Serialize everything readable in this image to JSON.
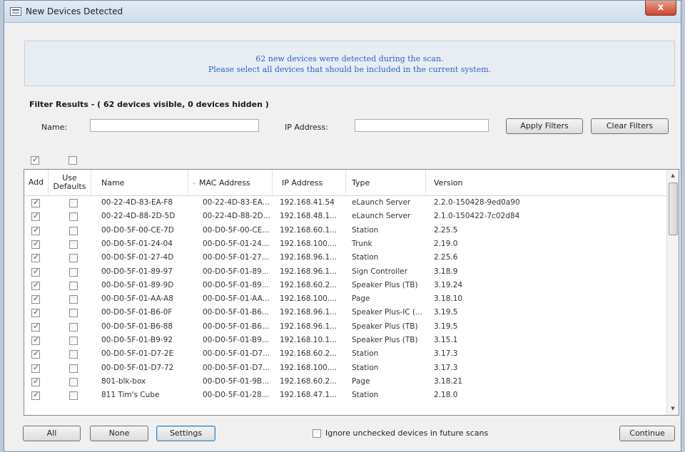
{
  "window": {
    "title": "New Devices Detected",
    "close_glyph": "x"
  },
  "banner": {
    "line1": "62 new devices were detected during the scan.",
    "line2": "Please select all devices that should be included in the current system."
  },
  "filter": {
    "title": "Filter Results - ( 62 devices visible, 0 devices hidden )",
    "name_label": "Name:",
    "name_value": "",
    "ip_label": "IP Address:",
    "ip_value": "",
    "apply_label": "Apply Filters",
    "clear_label": "Clear Filters"
  },
  "header_checks": {
    "add_all": true,
    "use_defaults_all": false
  },
  "table": {
    "columns": {
      "add": "Add",
      "use_defaults": "Use Defaults",
      "name": "Name",
      "sort_glyph": "-",
      "mac": "MAC Address",
      "ip": "IP Address",
      "type": "Type",
      "version": "Version"
    },
    "rows": [
      {
        "add": true,
        "use_defaults": false,
        "name": "00-22-4D-83-EA-F8",
        "mac": "00-22-4D-83-EA...",
        "ip": "192.168.41.54",
        "type": "eLaunch Server",
        "version": "2.2.0-150428-9ed0a90"
      },
      {
        "add": true,
        "use_defaults": false,
        "name": "00-22-4D-88-2D-5D",
        "mac": "00-22-4D-88-2D...",
        "ip": "192.168.48.1...",
        "type": "eLaunch Server",
        "version": "2.1.0-150422-7c02d84"
      },
      {
        "add": true,
        "use_defaults": false,
        "name": "00-D0-5F-00-CE-7D",
        "mac": "00-D0-5F-00-CE...",
        "ip": "192.168.60.1...",
        "type": "Station",
        "version": "2.25.5"
      },
      {
        "add": true,
        "use_defaults": false,
        "name": "00-D0-5F-01-24-04",
        "mac": "00-D0-5F-01-24...",
        "ip": "192.168.100....",
        "type": "Trunk",
        "version": "2.19.0"
      },
      {
        "add": true,
        "use_defaults": false,
        "name": "00-D0-5F-01-27-4D",
        "mac": "00-D0-5F-01-27...",
        "ip": "192.168.96.1...",
        "type": "Station",
        "version": "2.25.6"
      },
      {
        "add": true,
        "use_defaults": false,
        "name": "00-D0-5F-01-89-97",
        "mac": "00-D0-5F-01-89...",
        "ip": "192.168.96.1...",
        "type": "Sign Controller",
        "version": "3.18.9"
      },
      {
        "add": true,
        "use_defaults": false,
        "name": "00-D0-5F-01-89-9D",
        "mac": "00-D0-5F-01-89...",
        "ip": "192.168.60.2...",
        "type": "Speaker Plus (TB)",
        "version": "3.19.24"
      },
      {
        "add": true,
        "use_defaults": false,
        "name": "00-D0-5F-01-AA-A8",
        "mac": "00-D0-5F-01-AA...",
        "ip": "192.168.100....",
        "type": "Page",
        "version": "3.18.10"
      },
      {
        "add": true,
        "use_defaults": false,
        "name": "00-D0-5F-01-B6-0F",
        "mac": "00-D0-5F-01-B6...",
        "ip": "192.168.96.1...",
        "type": "Speaker Plus-IC (...",
        "version": "3.19.5"
      },
      {
        "add": true,
        "use_defaults": false,
        "name": "00-D0-5F-01-B6-88",
        "mac": "00-D0-5F-01-B6...",
        "ip": "192.168.96.1...",
        "type": "Speaker Plus (TB)",
        "version": "3.19.5"
      },
      {
        "add": true,
        "use_defaults": false,
        "name": "00-D0-5F-01-B9-92",
        "mac": "00-D0-5F-01-B9...",
        "ip": "192.168.10.1...",
        "type": "Speaker Plus (TB)",
        "version": "3.15.1"
      },
      {
        "add": true,
        "use_defaults": false,
        "name": "00-D0-5F-01-D7-2E",
        "mac": "00-D0-5F-01-D7...",
        "ip": "192.168.60.2...",
        "type": "Station",
        "version": "3.17.3"
      },
      {
        "add": true,
        "use_defaults": false,
        "name": "00-D0-5F-01-D7-72",
        "mac": "00-D0-5F-01-D7...",
        "ip": "192.168.100....",
        "type": "Station",
        "version": "3.17.3"
      },
      {
        "add": true,
        "use_defaults": false,
        "name": "801-blk-box",
        "mac": "00-D0-5F-01-9B...",
        "ip": "192.168.60.2...",
        "type": "Page",
        "version": "3.18.21"
      },
      {
        "add": true,
        "use_defaults": false,
        "name": "811 Tim's Cube",
        "mac": "00-D0-5F-01-28...",
        "ip": "192.168.47.1...",
        "type": "Station",
        "version": "2.18.0"
      }
    ],
    "scroll_up_glyph": "▲",
    "scroll_down_glyph": "▼"
  },
  "footer": {
    "all_label": "All",
    "none_label": "None",
    "settings_label": "Settings",
    "ignore_checked": false,
    "ignore_label": "Ignore unchecked devices in future scans",
    "continue_label": "Continue"
  }
}
